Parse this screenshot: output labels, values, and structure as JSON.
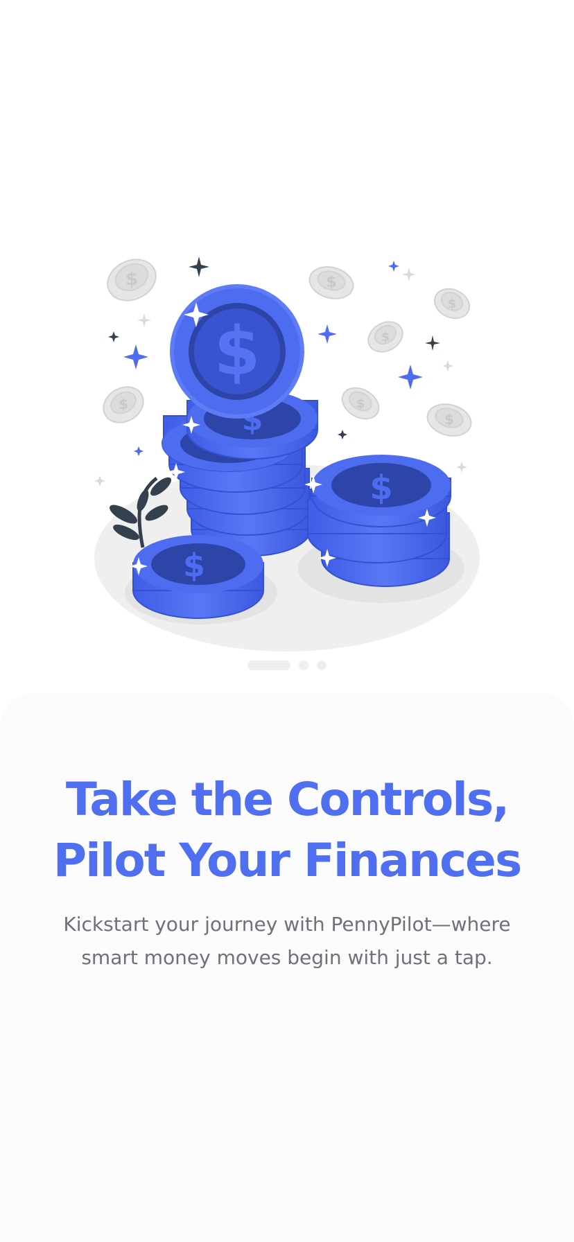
{
  "onboarding": {
    "headline_line1": "Take the Controls,",
    "headline_line2": "Pilot Your Finances",
    "subtitle": "Kickstart your journey with PennyPilot—where smart money moves begin with just a tap.",
    "illustration": "coin-stacks-illustration"
  },
  "pager": {
    "total": 3,
    "active": 1
  },
  "colors": {
    "accent": "#4f6ff0",
    "coin_blue": "#4e6cf0",
    "coin_dark": "#2d45a8",
    "subtitle_text": "#6e7177",
    "sheet_background": "#fbfbfb"
  }
}
